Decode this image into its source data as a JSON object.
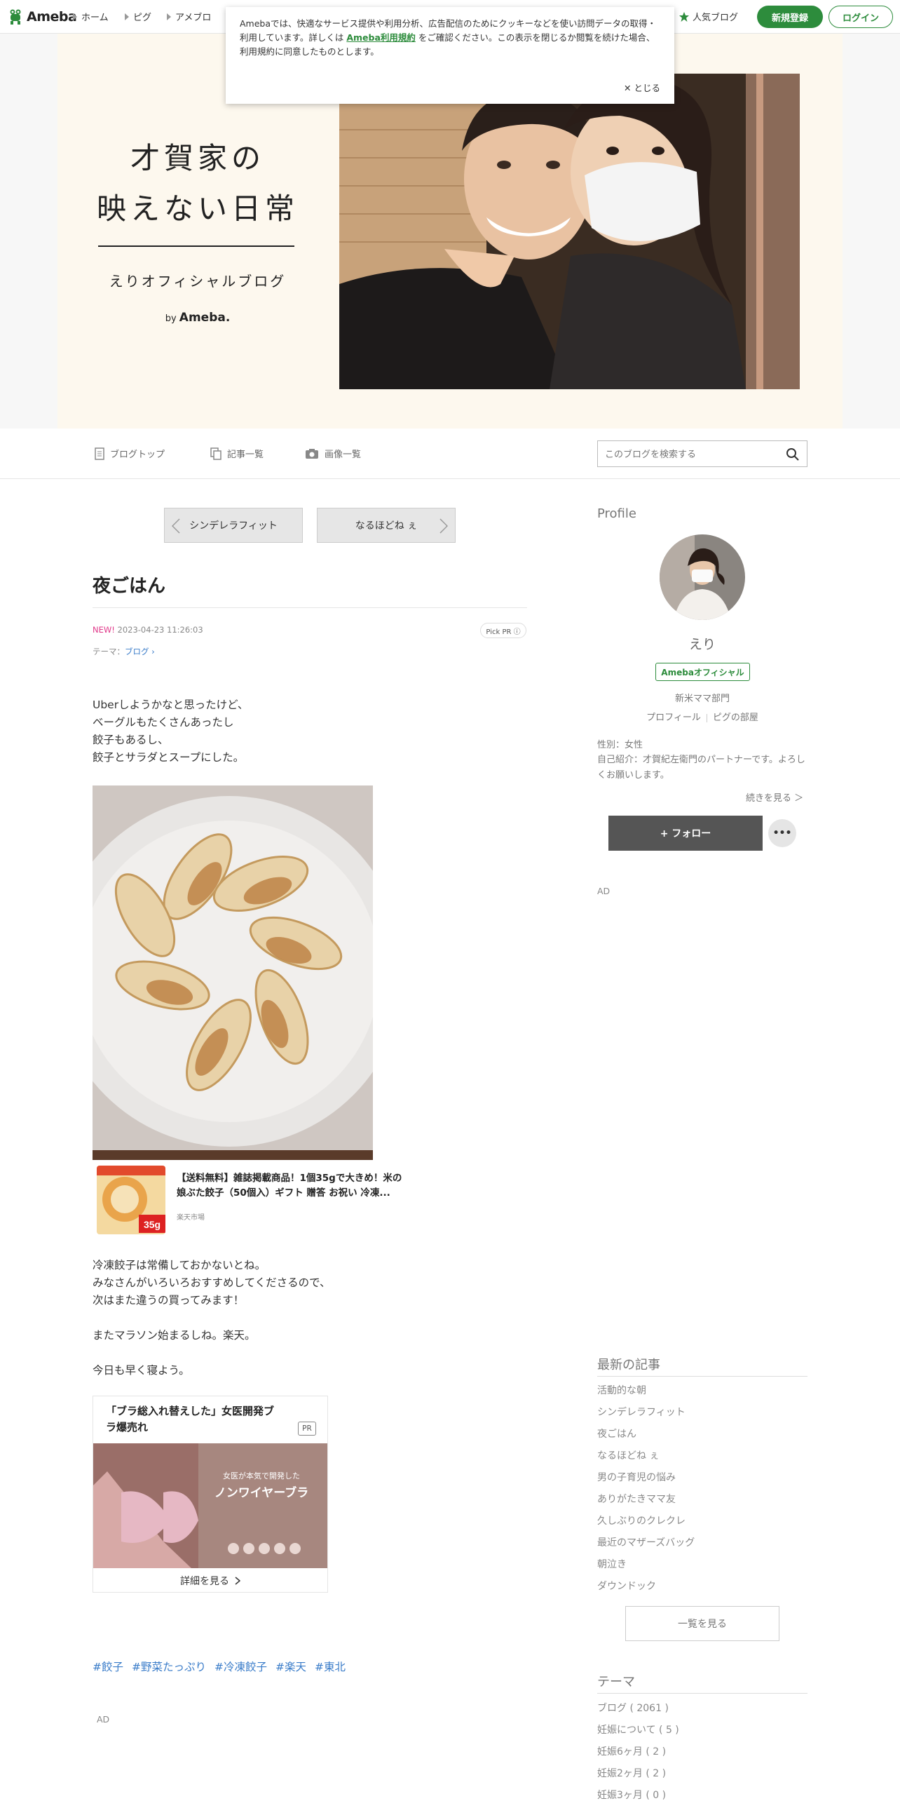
{
  "nav": {
    "logo_text": "Ameba",
    "links": [
      "ホーム",
      "ピグ",
      "アメブロ"
    ],
    "popular_blog": "人気ブログ",
    "register": "新規登録",
    "login": "ログイン"
  },
  "cookie": {
    "text_before": "Amebaでは、快適なサービス提供や利用分析、広告配信のためにクッキーなどを使い訪問データの取得・利用しています。詳しくは ",
    "link": "Ameba利用規約",
    "text_after": " をご確認ください。この表示を閉じるか閲覧を続けた場合、利用規約に同意したものとします。",
    "close": "✕ とじる"
  },
  "header": {
    "title_line1": "才賀家の",
    "title_line2": "映えない日常",
    "subtitle": "えりオフィシャルブログ",
    "by": "by",
    "by_brand": "Ameba."
  },
  "blognav": {
    "top": "ブログトップ",
    "list": "記事一覧",
    "images": "画像一覧",
    "search_placeholder": "このブログを検索する"
  },
  "pager": {
    "prev": "シンデレラフィット",
    "next": "なるほどね ぇ"
  },
  "article": {
    "title": "夜ごはん",
    "new_label": "NEW!",
    "datetime": "2023-04-23 11:26:03",
    "pick_pr": "Pick PR ⓘ",
    "theme_label": "テーマ：",
    "theme_value": "ブログ ›",
    "paragraph1": "Uberしようかなと思ったけど、\nベーグルもたくさんあったし\n餃子もあるし、\n餃子とサラダとスープにした。",
    "product_title": "【送料無料】雑誌掲載商品！1個35gで大きめ！米の娘ぶた餃子（50個入）ギフト 贈答 お祝い 冷凍...",
    "product_shop": "楽天市場",
    "product_badge": "35g",
    "paragraph2": "冷凍餃子は常備しておかないとね。\nみなさんがいろいろおすすめしてくださるので、\n次はまた違うの買ってみます！",
    "paragraph3": "またマラソン始まるしね。楽天。",
    "paragraph4": "今日も早く寝よう。",
    "ad_title": "「ブラ総入れ替えした」女医開発ブラ爆売れ",
    "ad_pr": "PR",
    "ad_more": "詳細を見る",
    "ad_overlay1": "女医が本気で開発した",
    "ad_overlay2": "ノンワイヤーブラ",
    "hashtags": [
      "#餃子",
      "#野菜たっぷり",
      "#冷凍餃子",
      "#楽天",
      "#東北"
    ],
    "ad_label": "AD"
  },
  "sidebar": {
    "profile_heading": "Profile",
    "name": "えり",
    "official": "Amebaオフィシャル",
    "dept": "新米ママ部門",
    "profile_link": "プロフィール",
    "pig_link": "ピグの部屋",
    "gender": "性別：女性",
    "intro": "自己紹介：才賀紀左衛門のパートナーです。よろしくお願いします。",
    "more": "続きを見る ＞",
    "follow": "+ フォロー",
    "dots": "•••",
    "ad": "AD",
    "latest_heading": "最新の記事",
    "latest": [
      "活動的な朝",
      "シンデレラフィット",
      "夜ごはん",
      "なるほどね ぇ",
      "男の子育児の悩み",
      "ありがたきママ友",
      "久しぶりのクレクレ",
      "最近のマザーズバッグ",
      "朝泣き",
      "ダウンドック"
    ],
    "see_all": "一覧を見る",
    "theme_heading": "テーマ",
    "themes": [
      "ブログ ( 2061 )",
      "妊娠について ( 5 )",
      "妊娠6ヶ月 ( 2 )",
      "妊娠2ヶ月 ( 2 )",
      "妊娠3ヶ月 ( 0 )"
    ]
  }
}
